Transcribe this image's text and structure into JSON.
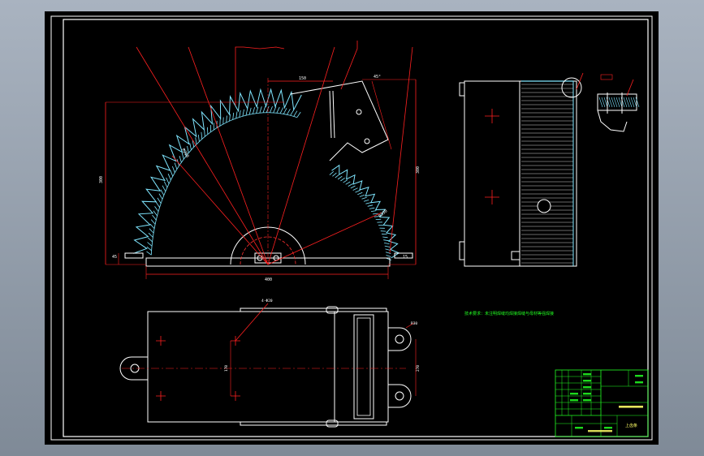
{
  "colors": {
    "canvas": "#000000",
    "frame": "#ffffff",
    "dimension": "#ff2020",
    "hatch": "#7fe6ff",
    "note": "#22ff22",
    "table": "#22ff22",
    "title_yellow": "#ffff66"
  },
  "note": {
    "text": "技术要求：未注明焊缝均焊接焊缝与母材等强焊接"
  },
  "dimensions": {
    "front": {
      "top_width": "150",
      "left_height": "300",
      "right_height": "300",
      "bottom_width": "400",
      "inner_radius": "R250",
      "outer_radius": "R350",
      "angle": "45°",
      "small_1": "45",
      "small_2": "15"
    },
    "plan": {
      "hole_label": "4-Φ20",
      "center_height": "170",
      "lug_right": "R30",
      "lug_span": "270"
    }
  },
  "title_block": {
    "drawing_title": "上齿条"
  }
}
